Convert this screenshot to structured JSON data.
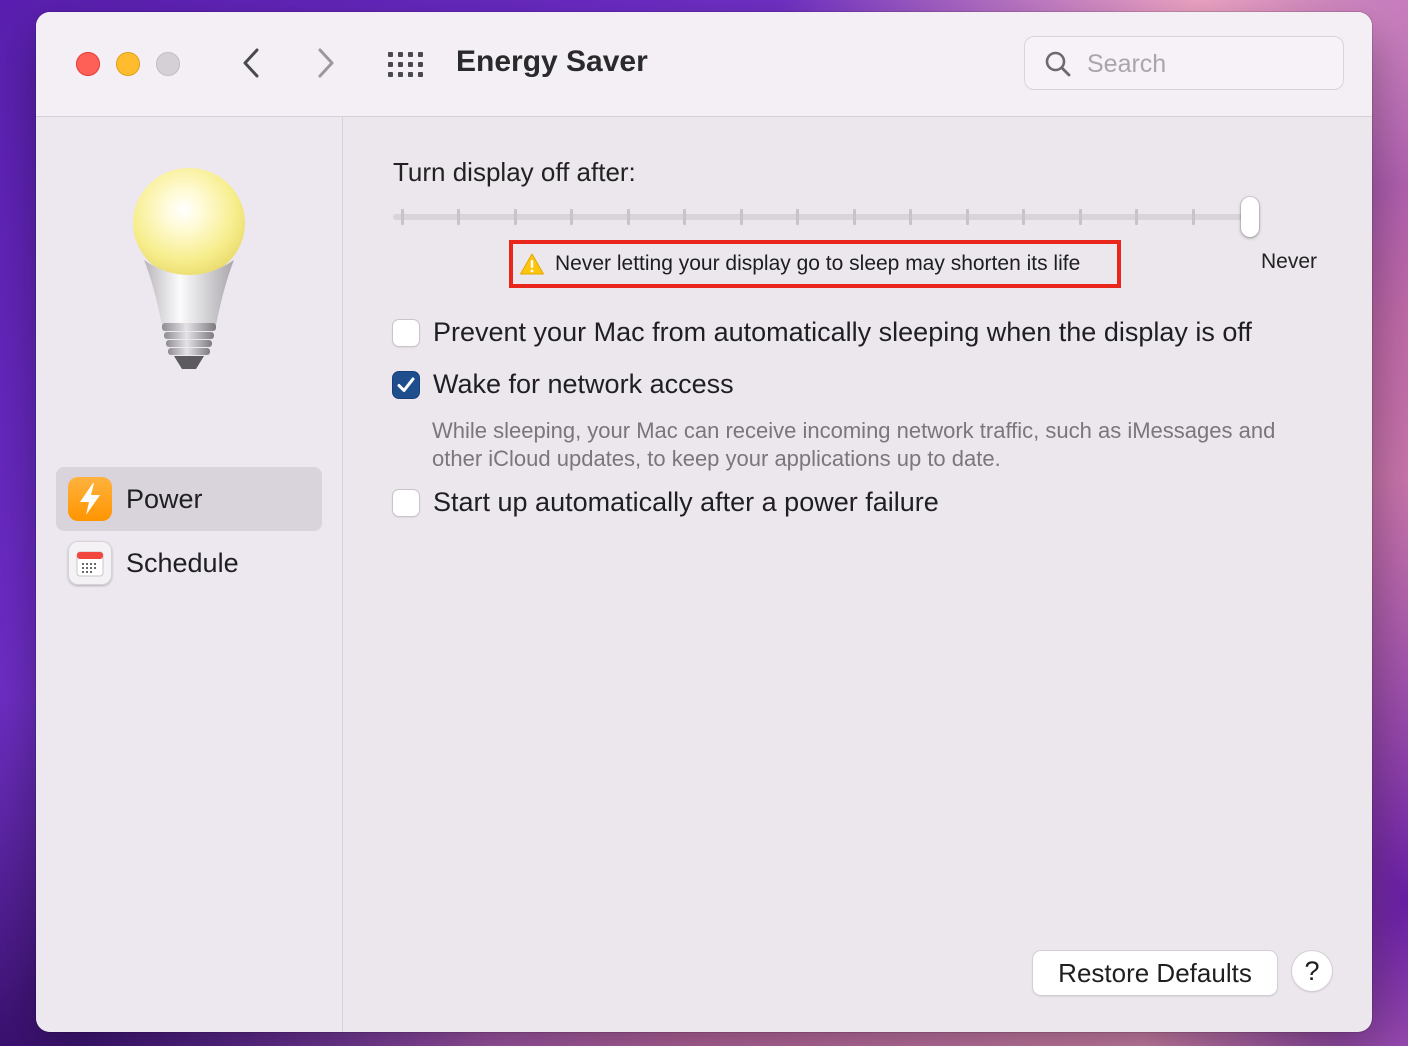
{
  "window": {
    "title": "Energy Saver",
    "traffic_lights": [
      "close",
      "minimize",
      "zoom"
    ]
  },
  "toolbar": {
    "back_icon": "chevron-left-icon",
    "forward_icon": "chevron-right-icon",
    "show_all_icon": "grid-icon"
  },
  "search": {
    "placeholder": "Search",
    "value": ""
  },
  "sidebar": {
    "header_icon": "lightbulb-icon",
    "items": [
      {
        "label": "Power",
        "icon": "bolt-icon",
        "selected": true
      },
      {
        "label": "Schedule",
        "icon": "calendar-icon",
        "selected": false
      }
    ]
  },
  "main": {
    "slider": {
      "title": "Turn display off after:",
      "value_label": "Never",
      "position_fraction": 1.0,
      "tick_count": 16
    },
    "warning": {
      "icon": "warning-triangle-icon",
      "text": "Never letting your display go to sleep may shorten its life",
      "highlight_color": "#e9261b"
    },
    "options": [
      {
        "label": "Prevent your Mac from automatically sleeping when the display is off",
        "checked": false
      },
      {
        "label": "Wake for network access",
        "checked": true
      },
      {
        "label": "Start up automatically after a power failure",
        "checked": false
      }
    ],
    "network_hint": "While sleeping, your Mac can receive incoming network traffic, such as iMessages and other iCloud updates, to keep your applications up to date.",
    "restore_defaults_label": "Restore Defaults",
    "help_label": "?"
  },
  "colors": {
    "accent_checkbox": "#1f4e8c",
    "sidebar_selected": "#d9d4db",
    "power_icon": "#ff9f0a"
  }
}
